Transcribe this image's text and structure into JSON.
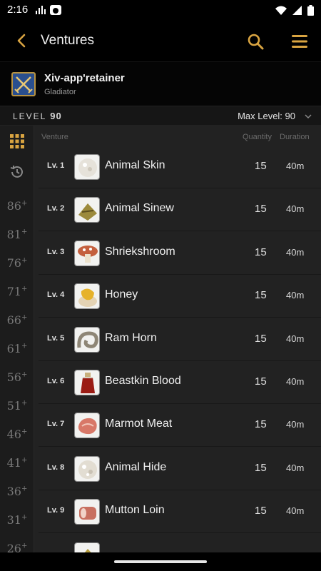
{
  "status": {
    "time": "2:16"
  },
  "appbar": {
    "title": "Ventures"
  },
  "retainer": {
    "name": "Xiv-app'retainer",
    "class": "Gladiator"
  },
  "levelbar": {
    "level_label": "LEVEL",
    "level_value": "90",
    "max_level": "Max Level: 90"
  },
  "columns": {
    "venture": "Venture",
    "quantity": "Quantity",
    "duration": "Duration"
  },
  "side_levels": [
    "86+",
    "81+",
    "76+",
    "71+",
    "66+",
    "61+",
    "56+",
    "51+",
    "46+",
    "41+",
    "36+",
    "31+",
    "26+"
  ],
  "ventures": [
    {
      "level": "Lv. 1",
      "name": "Animal Skin",
      "quantity": "15",
      "duration": "40m",
      "icon": "animal-skin-icon",
      "color": "#e6e2da"
    },
    {
      "level": "Lv. 2",
      "name": "Animal Sinew",
      "quantity": "15",
      "duration": "40m",
      "icon": "animal-sinew-icon",
      "color": "#9c8a3c"
    },
    {
      "level": "Lv. 3",
      "name": "Shriekshroom",
      "quantity": "15",
      "duration": "40m",
      "icon": "shriekshroom-icon",
      "color": "#c4603e"
    },
    {
      "level": "Lv. 4",
      "name": "Honey",
      "quantity": "15",
      "duration": "40m",
      "icon": "honey-icon",
      "color": "#e6b22a"
    },
    {
      "level": "Lv. 5",
      "name": "Ram Horn",
      "quantity": "15",
      "duration": "40m",
      "icon": "ram-horn-icon",
      "color": "#8e8676"
    },
    {
      "level": "Lv. 6",
      "name": "Beastkin Blood",
      "quantity": "15",
      "duration": "40m",
      "icon": "beastkin-blood-icon",
      "color": "#9a1c14"
    },
    {
      "level": "Lv. 7",
      "name": "Marmot Meat",
      "quantity": "15",
      "duration": "40m",
      "icon": "marmot-meat-icon",
      "color": "#d87868"
    },
    {
      "level": "Lv. 8",
      "name": "Animal Hide",
      "quantity": "15",
      "duration": "40m",
      "icon": "animal-hide-icon",
      "color": "#e2ddd2"
    },
    {
      "level": "Lv. 9",
      "name": "Mutton Loin",
      "quantity": "15",
      "duration": "40m",
      "icon": "mutton-loin-icon",
      "color": "#c87060"
    },
    {
      "level": "",
      "name": "",
      "quantity": "",
      "duration": "",
      "icon": "partial-item-icon",
      "color": "#b49a3c"
    }
  ]
}
